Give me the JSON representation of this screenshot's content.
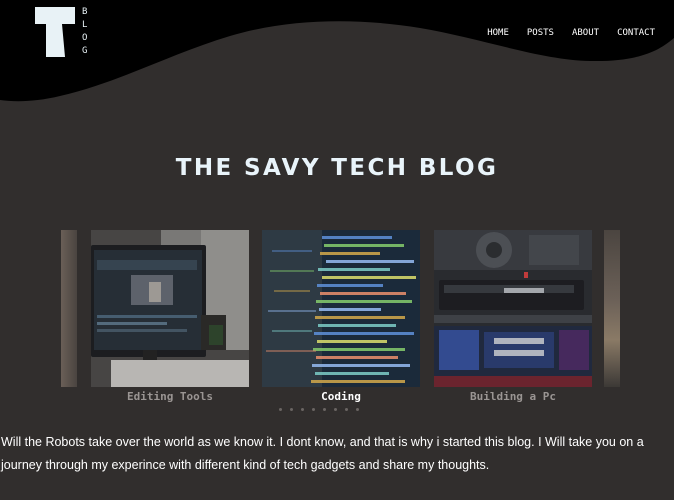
{
  "brand": {
    "logo_letter": "T",
    "logo_side_letters": [
      "B",
      "L",
      "O",
      "G"
    ]
  },
  "nav": {
    "items": [
      {
        "label": "HOME"
      },
      {
        "label": "POSTS"
      },
      {
        "label": "ABOUT"
      },
      {
        "label": "CONTACT"
      }
    ]
  },
  "hero": {
    "title": "THE SAVY TECH BLOG"
  },
  "carousel": {
    "slides": [
      {
        "caption": "Editing Tools",
        "active": false
      },
      {
        "caption": "Coding",
        "active": true
      },
      {
        "caption": "Building a Pc",
        "active": false
      }
    ],
    "dot_count": 8
  },
  "intro": {
    "text": "Will the Robots take over the world as we know it. I dont know, and that is why i started this blog. I Will take you on a journey through my experince with different kind of tech gadgets and share my thoughts."
  },
  "colors": {
    "background": "#312e2d",
    "header": "#000000",
    "logo": "#e8f2f6",
    "title": "#e9f4fa"
  }
}
